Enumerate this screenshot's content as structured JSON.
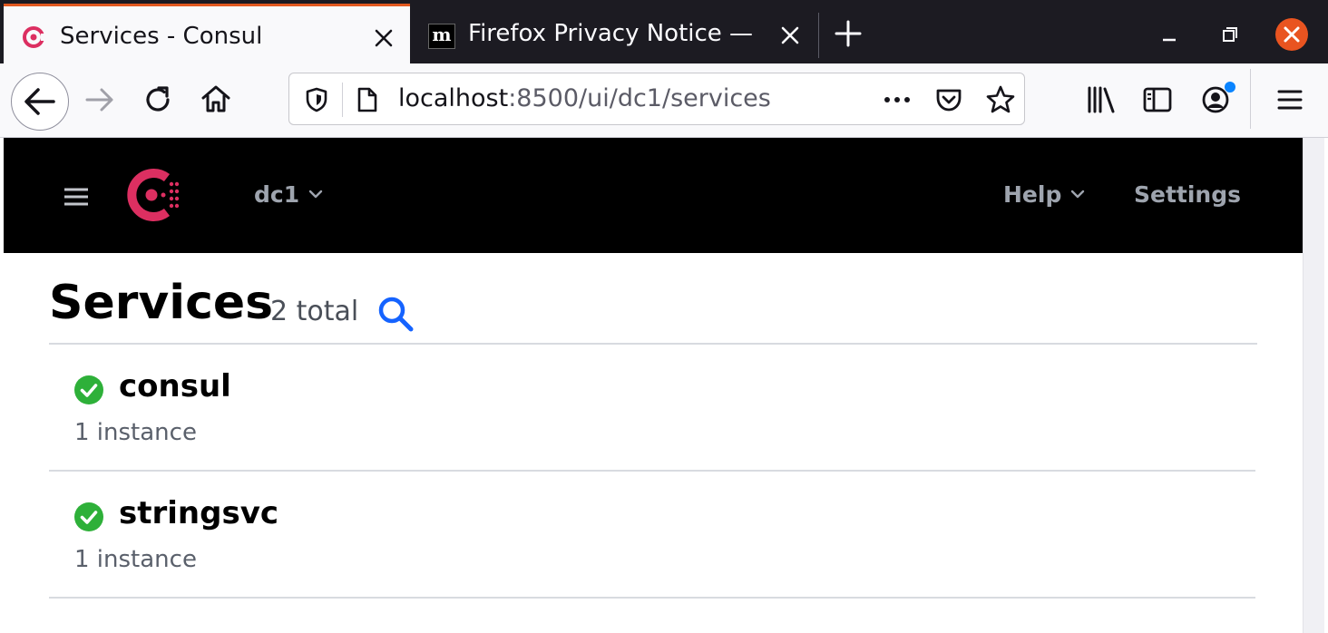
{
  "browser": {
    "tabs": [
      {
        "title": "Services - Consul",
        "active": true
      },
      {
        "title": "Firefox Privacy Notice —",
        "favicon_letter": "m",
        "active": false
      }
    ],
    "url": {
      "host": "localhost",
      "path": ":8500/ui/dc1/services"
    },
    "toolbar_icons": [
      "back-icon",
      "forward-icon",
      "reload-icon",
      "home-icon",
      "shield-icon",
      "page-icon",
      "more-icon",
      "pocket-icon",
      "star-icon",
      "library-icon",
      "sidebar-icon",
      "account-icon",
      "menu-icon"
    ]
  },
  "app": {
    "header": {
      "datacenter": "dc1",
      "help_label": "Help",
      "settings_label": "Settings"
    },
    "page": {
      "title": "Services",
      "total": "2 total"
    },
    "services": [
      {
        "name": "consul",
        "instances": "1 instance",
        "status": "passing"
      },
      {
        "name": "stringsvc",
        "instances": "1 instance",
        "status": "passing"
      }
    ],
    "colors": {
      "consul_brand": "#dc2f61",
      "passing": "#2eb039",
      "search_blue": "#1563ff",
      "firefox_tab_accent": "#e25920",
      "ubuntu_close": "#e95420"
    }
  }
}
